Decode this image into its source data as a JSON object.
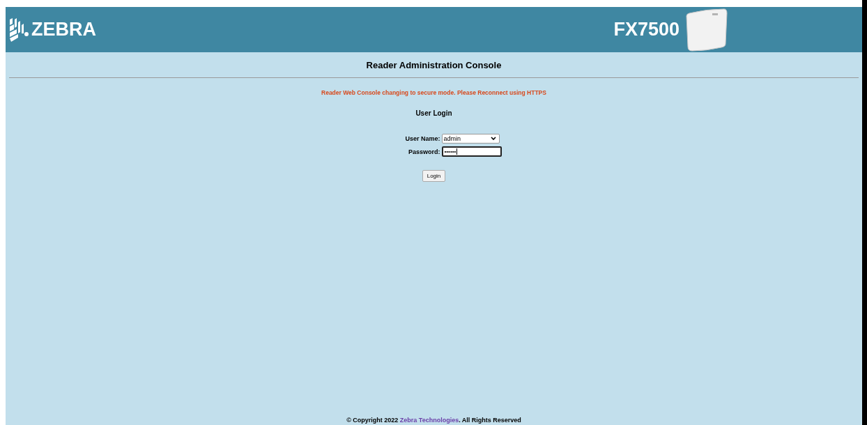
{
  "header": {
    "logo": "ZEBRA",
    "model": "FX7500"
  },
  "title": "Reader Administration Console",
  "notice": "Reader Web Console changing to secure mode. Please Reconnect using HTTPS",
  "login": {
    "heading": "User Login",
    "user_label": "User Name:",
    "user_value": "admin",
    "password_label": "Password:",
    "password_value": "••••••",
    "button": "Login"
  },
  "footer": {
    "copyright": "© Copyright 2022 ",
    "link": "Zebra Technologies",
    "rights": ". All Rights Reserved"
  }
}
